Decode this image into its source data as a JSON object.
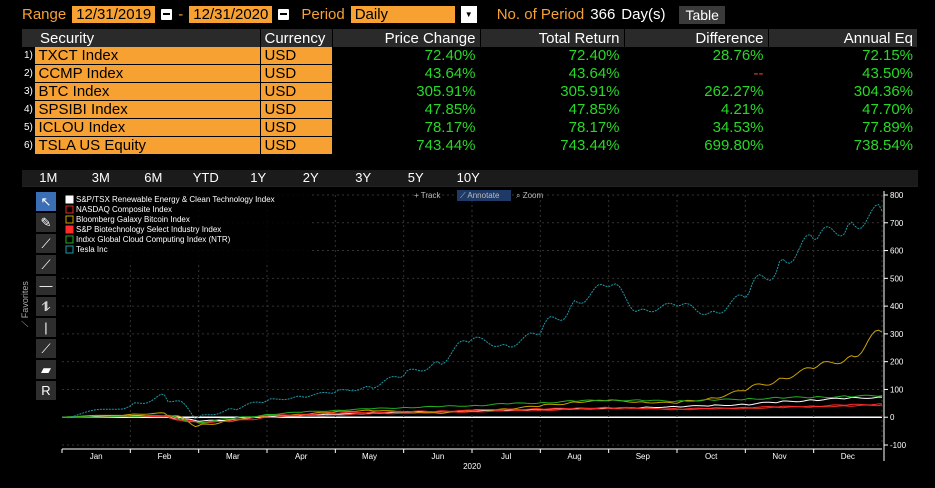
{
  "topbar": {
    "range_label": "Range",
    "start_date": "12/31/2019",
    "dash": "-",
    "end_date": "12/31/2020",
    "period_label": "Period",
    "period_value": "Daily",
    "num_period_label": "No. of Period",
    "num_period_value": "366",
    "num_period_unit": "Day(s)",
    "table_button": "Table"
  },
  "table": {
    "headers": [
      "Security",
      "Currency",
      "Price Change",
      "Total Return",
      "Difference",
      "Annual Eq"
    ],
    "rows": [
      {
        "num": "1)",
        "security": "TXCT Index",
        "currency": "USD",
        "price_change": "72.40%",
        "total_return": "72.40%",
        "difference": "28.76%",
        "annual_eq": "72.15%"
      },
      {
        "num": "2)",
        "security": "CCMP Index",
        "currency": "USD",
        "price_change": "43.64%",
        "total_return": "43.64%",
        "difference": "--",
        "annual_eq": "43.50%"
      },
      {
        "num": "3)",
        "security": "BTC Index",
        "currency": "USD",
        "price_change": "305.91%",
        "total_return": "305.91%",
        "difference": "262.27%",
        "annual_eq": "304.36%"
      },
      {
        "num": "4)",
        "security": "SPSIBI Index",
        "currency": "USD",
        "price_change": "47.85%",
        "total_return": "47.85%",
        "difference": "4.21%",
        "annual_eq": "47.70%"
      },
      {
        "num": "5)",
        "security": "ICLOU Index",
        "currency": "USD",
        "price_change": "78.17%",
        "total_return": "78.17%",
        "difference": "34.53%",
        "annual_eq": "77.89%"
      },
      {
        "num": "6)",
        "security": "TSLA US Equity",
        "currency": "USD",
        "price_change": "743.44%",
        "total_return": "743.44%",
        "difference": "699.80%",
        "annual_eq": "738.54%"
      }
    ]
  },
  "tabs": [
    "1M",
    "3M",
    "6M",
    "YTD",
    "1Y",
    "2Y",
    "3Y",
    "5Y",
    "10Y"
  ],
  "chart_toolbar": {
    "track": "Track",
    "annotate": "Annotate",
    "zoom": "Zoom"
  },
  "favorites_label": "Favorites",
  "colors": {
    "orange": "#f7a133",
    "green_value": "#26d926",
    "red_dash": "#e53a2a"
  },
  "chart_data": {
    "type": "line",
    "xlabel": "2020",
    "x_ticks": [
      "Jan",
      "Feb",
      "Mar",
      "Apr",
      "May",
      "Jun",
      "Jul",
      "Aug",
      "Sep",
      "Oct",
      "Nov",
      "Dec"
    ],
    "y_ticks": [
      800,
      700,
      600,
      500,
      400,
      300,
      200,
      100,
      0,
      -100
    ],
    "ylim": [
      -100,
      800
    ],
    "x": [
      0,
      1,
      1.5,
      2,
      2.5,
      3,
      3.5,
      4,
      4.5,
      5,
      5.5,
      6,
      6.5,
      7,
      7.5,
      8,
      8.5,
      9,
      9.5,
      10,
      10.5,
      11,
      11.5,
      12
    ],
    "legend_position": "top-left",
    "series": [
      {
        "name": "S&P/TSX Renewable Energy & Clean Technology Index",
        "color": "#ffffff",
        "values": [
          0,
          5,
          3,
          -15,
          -8,
          2,
          8,
          10,
          14,
          18,
          20,
          22,
          25,
          28,
          30,
          32,
          35,
          38,
          42,
          46,
          55,
          62,
          68,
          72
        ]
      },
      {
        "name": "NASDAQ Composite Index",
        "color": "#e0301e",
        "values": [
          0,
          3,
          2,
          -20,
          -15,
          0,
          5,
          8,
          12,
          15,
          18,
          20,
          22,
          25,
          28,
          32,
          30,
          28,
          30,
          32,
          35,
          38,
          40,
          44
        ]
      },
      {
        "name": "Bloomberg Galaxy Bitcoin Index",
        "color": "#c9a200",
        "values": [
          0,
          10,
          15,
          -30,
          -10,
          5,
          10,
          20,
          25,
          20,
          15,
          25,
          30,
          40,
          55,
          60,
          55,
          50,
          70,
          95,
          140,
          175,
          215,
          306
        ]
      },
      {
        "name": "S&P Biotechnology Select Industry Index",
        "color": "#ff2a2a",
        "values": [
          0,
          2,
          4,
          -22,
          -10,
          5,
          10,
          15,
          18,
          20,
          22,
          25,
          28,
          30,
          32,
          35,
          33,
          30,
          32,
          35,
          38,
          40,
          44,
          48
        ]
      },
      {
        "name": "Indxx Global Cloud Computing Index (NTR)",
        "color": "#22b022",
        "values": [
          0,
          4,
          6,
          -18,
          -5,
          10,
          18,
          25,
          30,
          35,
          38,
          42,
          48,
          52,
          58,
          62,
          60,
          58,
          62,
          65,
          70,
          72,
          75,
          78
        ]
      },
      {
        "name": "Tesla Inc",
        "color": "#1a9aa8",
        "values": [
          0,
          40,
          80,
          0,
          30,
          60,
          75,
          90,
          110,
          150,
          200,
          280,
          260,
          300,
          420,
          470,
          390,
          400,
          380,
          430,
          560,
          640,
          690,
          743
        ]
      }
    ]
  }
}
